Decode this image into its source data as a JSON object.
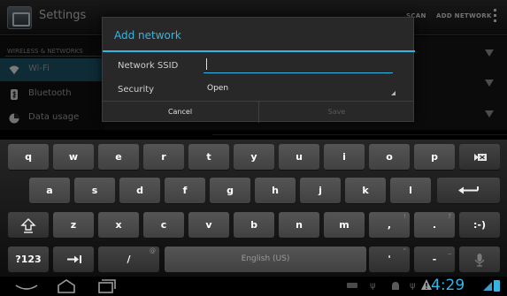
{
  "actionbar": {
    "title": "Settings",
    "scan_label": "SCAN",
    "add_network_label": "ADD NETWORK"
  },
  "sidebar": {
    "section_header": "WIRELESS & NETWORKS",
    "items": [
      {
        "label": "Wi-Fi",
        "icon": "wifi-icon",
        "selected": true
      },
      {
        "label": "Bluetooth",
        "icon": "bluetooth-icon"
      },
      {
        "label": "Data usage",
        "icon": "data-usage-icon"
      }
    ]
  },
  "dialog": {
    "title": "Add network",
    "ssid_label": "Network SSID",
    "ssid_value": "",
    "security_label": "Security",
    "security_value": "Open",
    "cancel_label": "Cancel",
    "save_label": "Save"
  },
  "keyboard": {
    "row1": [
      "q",
      "w",
      "e",
      "r",
      "t",
      "y",
      "u",
      "i",
      "o",
      "p"
    ],
    "row2": [
      "a",
      "s",
      "d",
      "f",
      "g",
      "h",
      "j",
      "k",
      "l"
    ],
    "row3": [
      "z",
      "x",
      "c",
      "v",
      "b",
      "n",
      "m",
      ",",
      "."
    ],
    "row3_hints": [
      "!",
      "?"
    ],
    "symbols_label": "?123",
    "slash_label": "/",
    "slash_hint": "@",
    "space_label": "English (US)",
    "apostrophe_label": "'",
    "apostrophe_hint": "\"",
    "dash_label": "-",
    "dash_hint": "_",
    "smiley_label": ":-)"
  },
  "navbar": {
    "clock": "4:29"
  },
  "colors": {
    "accent": "#33b5e5",
    "selected_row": "#1c4f63"
  }
}
